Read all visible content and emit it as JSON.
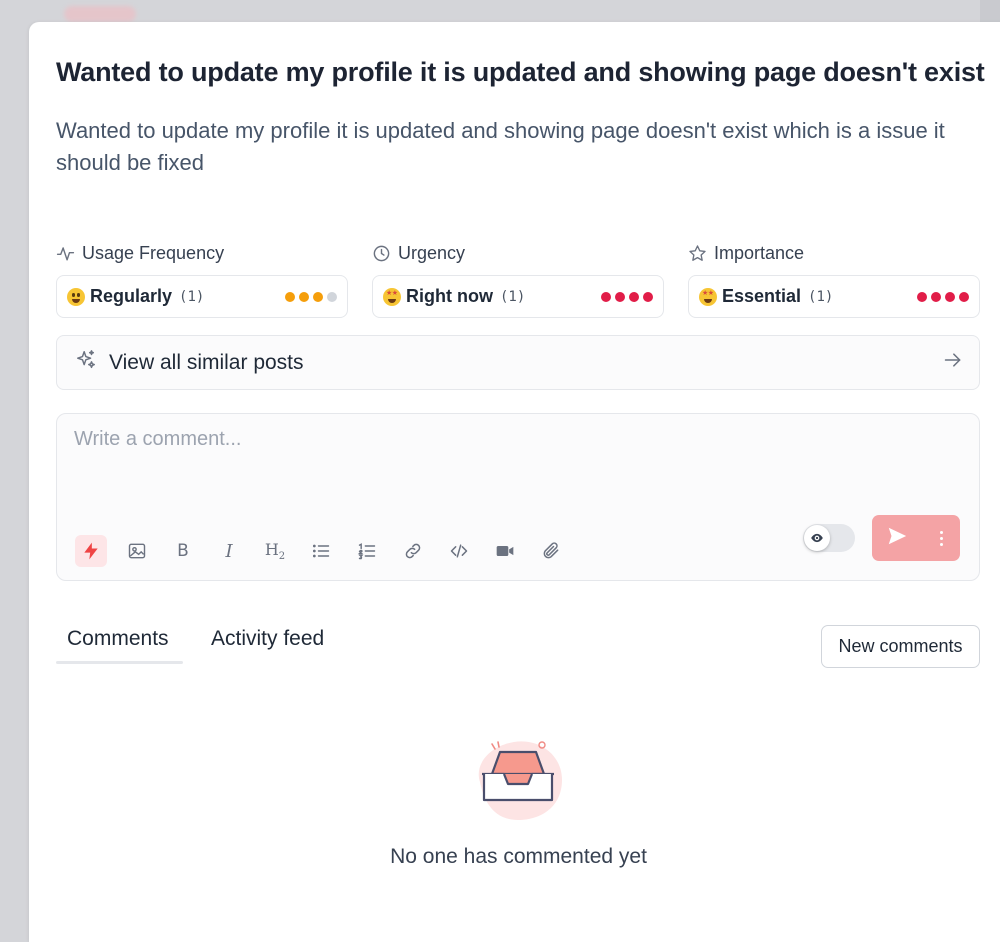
{
  "post": {
    "title": "Wanted to update my profile it is updated and showing page doesn't exist",
    "description": "Wanted to update my profile it is updated and showing page doesn't exist which is a issue it should be fixed"
  },
  "attributes": [
    {
      "label": "Usage Frequency",
      "icon": "activity-icon",
      "emoji": "grinning-face",
      "value": "Regularly",
      "count": "(1)",
      "level": 3,
      "max_level": 4,
      "color": "#f59e0b"
    },
    {
      "label": "Urgency",
      "icon": "clock-icon",
      "emoji": "star-struck-face",
      "value": "Right now",
      "count": "(1)",
      "level": 4,
      "max_level": 4,
      "color": "#e11d48"
    },
    {
      "label": "Importance",
      "icon": "star-icon",
      "emoji": "star-struck-face",
      "value": "Essential",
      "count": "(1)",
      "level": 4,
      "max_level": 4,
      "color": "#e11d48"
    }
  ],
  "similar_posts": {
    "label": "View all similar posts",
    "icon": "sparkles-icon",
    "arrow_icon": "arrow-right-icon"
  },
  "composer": {
    "placeholder": "Write a comment...",
    "toolbar": [
      "lightning-icon",
      "image-icon",
      "bold-icon",
      "italic-icon",
      "heading-icon",
      "bullet-list-icon",
      "numbered-list-icon",
      "link-icon",
      "code-icon",
      "video-icon",
      "attachment-icon"
    ],
    "toolbar_labels": {
      "bold": "B",
      "italic": "I",
      "heading": "H",
      "heading_sub": "2"
    },
    "visibility_toggle_icon": "eye-icon",
    "send_icon": "send-icon",
    "more_icon": "more-vertical-icon",
    "accent_color": "#f4a3a5"
  },
  "tabs": [
    {
      "label": "Comments",
      "active": true
    },
    {
      "label": "Activity feed",
      "active": false
    }
  ],
  "sort_button": {
    "label": "New comments"
  },
  "empty_state": {
    "icon": "empty-inbox-icon",
    "message": "No one has commented yet"
  }
}
